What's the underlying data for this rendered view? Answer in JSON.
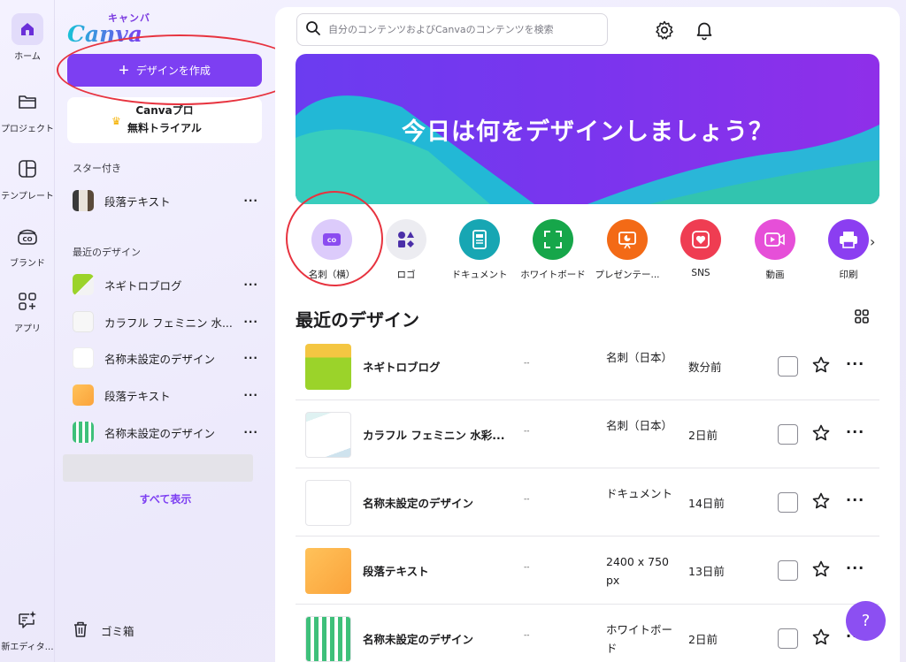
{
  "rail": {
    "items": [
      {
        "label": "ホーム",
        "icon": "home-icon"
      },
      {
        "label": "プロジェクト",
        "icon": "folder-icon"
      },
      {
        "label": "テンプレート",
        "icon": "template-icon"
      },
      {
        "label": "ブランド",
        "icon": "brand-icon"
      },
      {
        "label": "アプリ",
        "icon": "apps-icon"
      }
    ],
    "new_editor": "新エディタ…"
  },
  "logo": {
    "kata": "キャンバ",
    "word": "Canva"
  },
  "create_button": "デザインを作成",
  "trial": {
    "line1": "Canvaプロ",
    "line2": "無料トライアル"
  },
  "starred": {
    "heading": "スター付き",
    "items": [
      {
        "label": "段落テキスト"
      }
    ]
  },
  "recent_side": {
    "heading": "最近のデザイン",
    "items": [
      {
        "label": "ネギトロブログ"
      },
      {
        "label": "カラフル フェミニン 水..."
      },
      {
        "label": "名称未設定のデザイン"
      },
      {
        "label": "段落テキスト"
      },
      {
        "label": "名称未設定のデザイン"
      }
    ]
  },
  "show_all": "すべて表示",
  "trash": "ゴミ箱",
  "search": {
    "placeholder": "自分のコンテンツおよびCanvaのコンテンツを検索"
  },
  "hero": {
    "title": "今日は何をデザインしましょう？"
  },
  "categories": [
    {
      "label": "名刺（横）",
      "icon": "business-card-icon",
      "color": "#dccbfb"
    },
    {
      "label": "ロゴ",
      "icon": "logo-shapes-icon",
      "color": "#ececf1"
    },
    {
      "label": "ドキュメント",
      "icon": "document-icon",
      "color": "#17a6b3"
    },
    {
      "label": "ホワイトボード",
      "icon": "whiteboard-icon",
      "color": "#16a64a"
    },
    {
      "label": "プレゼンテー...",
      "icon": "presentation-icon",
      "color": "#f36a16"
    },
    {
      "label": "SNS",
      "icon": "heart-icon",
      "color": "#ef3d52"
    },
    {
      "label": "動画",
      "icon": "video-icon",
      "color": "#e64fd8"
    },
    {
      "label": "印刷",
      "icon": "print-icon",
      "color": "#8b3ef1"
    }
  ],
  "recent": {
    "heading": "最近のデザイン",
    "rows": [
      {
        "name": "ネギトロブログ",
        "dash": "--",
        "type": "名刺（日本）",
        "time": "数分前"
      },
      {
        "name": "カラフル フェミニン 水彩...",
        "dash": "--",
        "type": "名刺（日本）",
        "time": "2日前"
      },
      {
        "name": "名称未設定のデザイン",
        "dash": "--",
        "type": "ドキュメント",
        "time": "14日前"
      },
      {
        "name": "段落テキスト",
        "dash": "--",
        "type": "2400 x 750 px",
        "time": "13日前"
      },
      {
        "name": "名称未設定のデザイン",
        "dash": "--",
        "type": "ホワイトボード",
        "time": "2日前"
      }
    ]
  },
  "help": "?"
}
